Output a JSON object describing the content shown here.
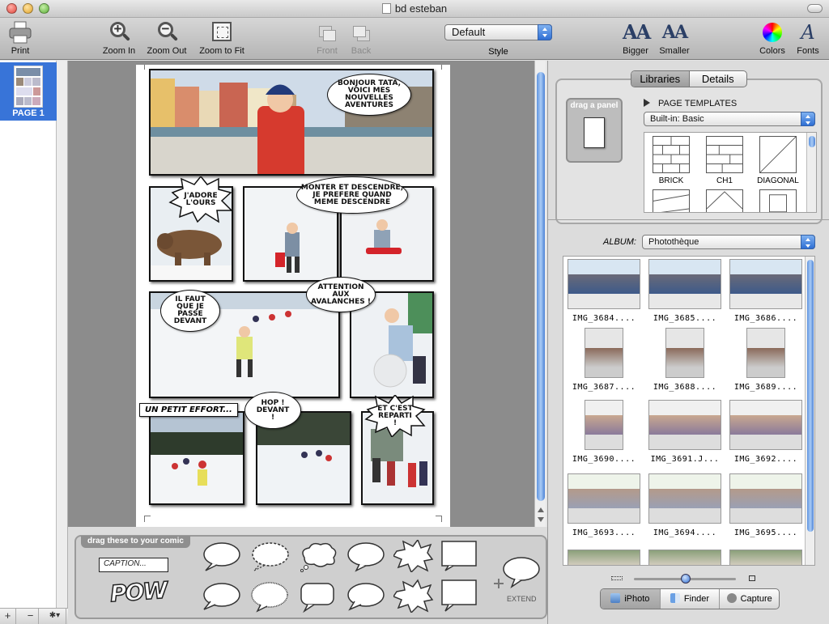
{
  "window": {
    "title": "bd esteban"
  },
  "toolbar": {
    "print": "Print",
    "zoom_in": "Zoom In",
    "zoom_out": "Zoom Out",
    "zoom_fit": "Zoom to Fit",
    "front": "Front",
    "back": "Back",
    "style_value": "Default",
    "style_label": "Style",
    "bigger": "Bigger",
    "smaller": "Smaller",
    "colors": "Colors",
    "fonts": "Fonts",
    "bigger_glyph": "AA",
    "smaller_glyph": "AA",
    "fonts_glyph": "A"
  },
  "sidebar": {
    "page_label": "PAGE 1",
    "add": "+",
    "remove": "−",
    "action": "✱▾"
  },
  "comic": {
    "bubble1": "BONJOUR TATA, VOICI MES NOUVELLES AVENTURES",
    "bubble2": "J'ADORE L'OURS",
    "bubble3": "MONTER ET DESCENDRE, JE PREFERE QUAND MEME DESCENDRE",
    "bubble4": "IL FAUT QUE JE PASSE DEVANT",
    "bubble5": "ATTENTION AUX AVALANCHES !",
    "caption1": "UN PETIT EFFORT...",
    "bubble6": "HOP ! DEVANT !",
    "bubble7": "ET C'EST REPARTI !"
  },
  "drag_area": {
    "title": "drag these to your comic",
    "caption": "CAPTION...",
    "pow": "POW",
    "extend": "EXTEND"
  },
  "library": {
    "tab_libraries": "Libraries",
    "tab_details": "Details",
    "drag_panel": "drag a panel",
    "page_templates": "PAGE TEMPLATES",
    "template_set": "Built-in: Basic",
    "templates": [
      "BRICK",
      "CH1",
      "DIAGONAL"
    ],
    "album_label": "ALBUM:",
    "album_value": "Photothèque",
    "photos": [
      "IMG_3684....",
      "IMG_3685....",
      "IMG_3686....",
      "IMG_3687....",
      "IMG_3688....",
      "IMG_3689....",
      "IMG_3690....",
      "IMG_3691.J...",
      "IMG_3692....",
      "IMG_3693....",
      "IMG_3694....",
      "IMG_3695...."
    ],
    "source_tabs": [
      "iPhoto",
      "Finder",
      "Capture"
    ]
  },
  "colors": {
    "selection": "#3874d8",
    "accent": "#2f6fd4"
  }
}
